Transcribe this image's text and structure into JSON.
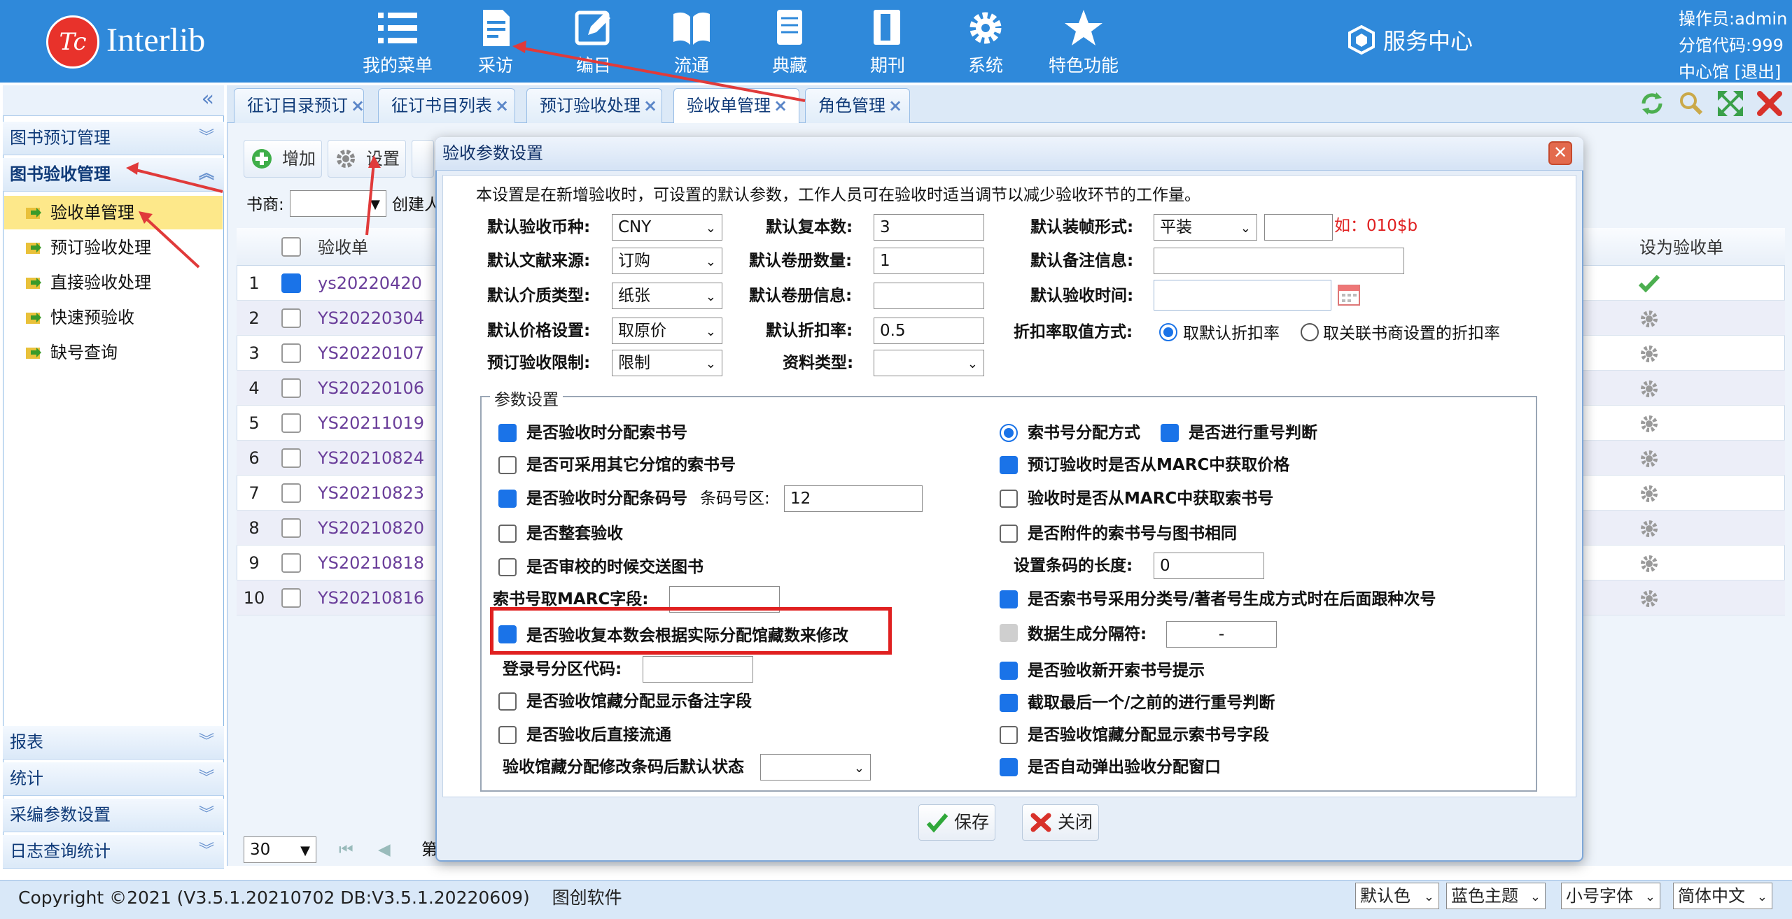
{
  "header": {
    "logo_mark": "Tc",
    "logo_text": "Interlib",
    "nav": [
      {
        "label": "我的菜单",
        "icon": "list-icon"
      },
      {
        "label": "采访",
        "icon": "document-icon"
      },
      {
        "label": "编目",
        "icon": "edit-icon"
      },
      {
        "label": "流通",
        "icon": "book-icon"
      },
      {
        "label": "典藏",
        "icon": "archive-icon"
      },
      {
        "label": "期刊",
        "icon": "journal-icon"
      },
      {
        "label": "系统",
        "icon": "gear-icon"
      },
      {
        "label": "特色功能",
        "icon": "star-icon"
      }
    ],
    "service_center": "服务中心",
    "operator": "操作员:admin",
    "branch_code": "分馆代码:999",
    "branch_name": "中心馆",
    "logout": "[退出]"
  },
  "sidebar": {
    "collapse": "«",
    "sections": [
      {
        "label": "图书预订管理"
      },
      {
        "label": "图书验收管理"
      }
    ],
    "items": [
      "验收单管理",
      "预订验收处理",
      "直接验收处理",
      "快速预验收",
      "缺号查询"
    ],
    "bottom_sections": [
      "报表",
      "统计",
      "采编参数设置",
      "日志查询统计"
    ]
  },
  "tabs": [
    {
      "label": "征订目录预订"
    },
    {
      "label": "征订书目列表"
    },
    {
      "label": "预订验收处理"
    },
    {
      "label": "验收单管理"
    },
    {
      "label": "角色管理"
    }
  ],
  "toolbar": {
    "add": "增加",
    "settings": "设置",
    "supplier": "书商:",
    "creator": "创建人"
  },
  "grid": {
    "col_name": "验收单",
    "col_set": "设为验收单",
    "rows": [
      {
        "n": "1",
        "id": "ys20220420",
        "checked": true
      },
      {
        "n": "2",
        "id": "YS20220304"
      },
      {
        "n": "3",
        "id": "YS20220107"
      },
      {
        "n": "4",
        "id": "YS20220106"
      },
      {
        "n": "5",
        "id": "YS20211019"
      },
      {
        "n": "6",
        "id": "YS20210824"
      },
      {
        "n": "7",
        "id": "YS20210823"
      },
      {
        "n": "8",
        "id": "YS20210820"
      },
      {
        "n": "9",
        "id": "YS20210818"
      },
      {
        "n": "10",
        "id": "YS20210816"
      }
    ],
    "page_size": "30",
    "page_label": "第"
  },
  "dialog": {
    "title": "验收参数设置",
    "close": "✕",
    "intro": "本设置是在新增验收时，可设置的默认参数，工作人员可在验收时适当调节以减少验收环节的工作量。",
    "currency_label": "默认验收币种:",
    "currency": "CNY",
    "copies_label": "默认复本数:",
    "copies": "3",
    "binding_label": "默认装帧形式:",
    "binding": "平装",
    "binding_hint": "如：010$b",
    "source_label": "默认文献来源:",
    "source": "订购",
    "volumes_label": "默认卷册数量:",
    "volumes": "1",
    "note_label": "默认备注信息:",
    "media_label": "默认介质类型:",
    "media": "纸张",
    "volinfo_label": "默认卷册信息:",
    "time_label": "默认验收时间:",
    "price_label": "默认价格设置:",
    "price": "取原价",
    "discount_label": "默认折扣率:",
    "discount": "0.5",
    "discount_mode_label": "折扣率取值方式:",
    "discount_mode_a": "取默认折扣率",
    "discount_mode_b": "取关联书商设置的折扣率",
    "limit_label": "预订验收限制:",
    "limit": "限制",
    "doctype_label": "资料类型:",
    "legend": "参数设置",
    "left_opts": [
      "是否验收时分配索书号",
      "是否可采用其它分馆的索书号",
      "是否验收时分配条码号",
      "是否整套验收",
      "是否审校的时候交送图书"
    ],
    "barcode_zone_label": "条码号区:",
    "barcode_zone": "12",
    "marc_label": "索书号取MARC字段:",
    "highlight_opt": "是否验收复本数会根据实际分配馆藏数来修改",
    "reg_zone_label": "登录号分区代码:",
    "note_opt": "是否验收馆藏分配显示备注字段",
    "circ_opt": "是否验收后直接流通",
    "default_state_label": "验收馆藏分配修改条码后默认状态",
    "right_opts": {
      "alloc_mode": "索书号分配方式",
      "dup_check": "是否进行重号判断",
      "price_marc": "预订验收时是否从MARC中获取价格",
      "callno_marc": "验收时是否从MARC中获取索书号",
      "attach_same": "是否附件的索书号与图书相同",
      "barcode_len_label": "设置条码的长度:",
      "barcode_len": "0",
      "class_author": "是否索书号采用分类号/著者号生成方式时在后面跟种次号",
      "separator_label": "数据生成分隔符:",
      "separator": "-",
      "new_call_hint": "是否验收新开索书号提示",
      "cut_last": "截取最后一个/之前的进行重号判断",
      "show_callno": "是否验收馆藏分配显示索书号字段",
      "auto_popup": "是否自动弹出验收分配窗口"
    },
    "save": "保存",
    "cancel": "关闭"
  },
  "footer": {
    "copyright": "Copyright ©2021 (V3.5.1.20210702 DB:V3.5.1.20220609)",
    "company": "图创软件",
    "color": "默认色",
    "theme": "蓝色主题",
    "font": "小号字体",
    "lang": "简体中文"
  }
}
